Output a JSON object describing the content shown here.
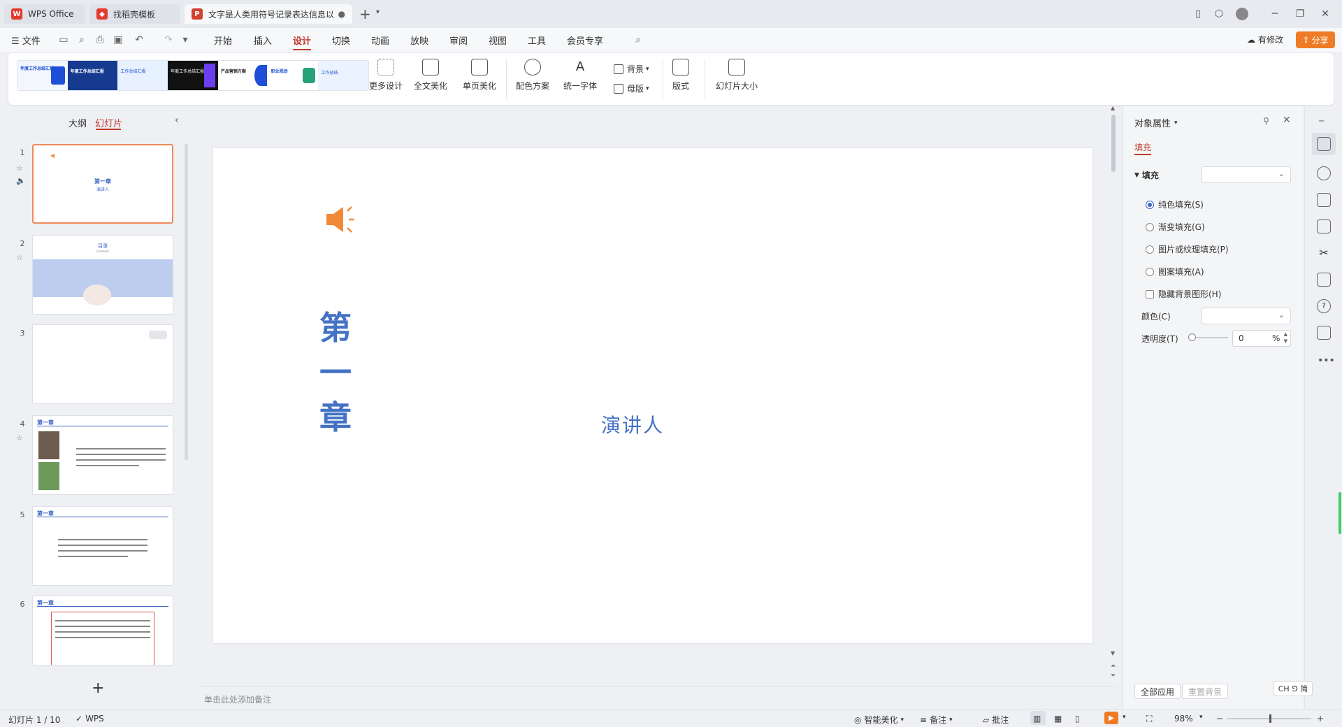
{
  "titlebar": {
    "tabs": [
      {
        "label": "WPS Office"
      },
      {
        "label": "找稻壳模板"
      },
      {
        "label": "文字是人类用符号记录表达信息以"
      }
    ],
    "new_tab_glyph": "+"
  },
  "menubar": {
    "file": "文件",
    "items": [
      "开始",
      "插入",
      "设计",
      "切换",
      "动画",
      "放映",
      "审阅",
      "视图",
      "工具",
      "会员专享"
    ],
    "active": "设计",
    "has_changes": "有修改",
    "share": "分享"
  },
  "ribbon": {
    "more_design": "更多设计",
    "beautify_all": "全文美化",
    "beautify_page": "单页美化",
    "color_scheme": "配色方案",
    "unify_font": "统一字体",
    "background": "背景",
    "master": "母版",
    "layout": "版式",
    "slide_size": "幻灯片大小",
    "templates": [
      {
        "title": "年度工作总结汇报",
        "color": "#1e4fd6"
      },
      {
        "title": "年度工作总结汇报",
        "color": "#163a8f"
      },
      {
        "title": "工作总结汇报",
        "color": "#e8f1ff"
      },
      {
        "title": "年度工作总结汇报",
        "color": "#111111"
      },
      {
        "title": "产品营销方案",
        "color": "#ffffff"
      },
      {
        "title": "职业规划",
        "color": "#1e4fd6"
      },
      {
        "title": "工作总结",
        "color": "#eaf3ff"
      }
    ]
  },
  "leftpanel": {
    "tab_outline": "大纲",
    "tab_slides": "幻灯片",
    "slides": [
      {
        "num": "1",
        "title": "第一章",
        "sub": "演讲人"
      },
      {
        "num": "2",
        "title": "目录",
        "sub": "Contents"
      },
      {
        "num": "3"
      },
      {
        "num": "4",
        "title": "第一章"
      },
      {
        "num": "5",
        "title": "第一章"
      },
      {
        "num": "6",
        "title": "第一章"
      }
    ],
    "add_glyph": "+"
  },
  "slide": {
    "title": "第一章",
    "subtitle": "演讲人"
  },
  "notes": {
    "placeholder": "单击此处添加备注"
  },
  "props": {
    "title": "对象属性",
    "tab_fill": "填充",
    "section_fill": "填充",
    "options": [
      "纯色填充(S)",
      "渐变填充(G)",
      "图片或纹理填充(P)",
      "图案填充(A)"
    ],
    "selected_option": "纯色填充(S)",
    "hide_bg": "隐藏背景图形(H)",
    "color_label": "颜色(C)",
    "transparency_label": "透明度(T)",
    "transparency_value": "0",
    "transparency_unit": "%",
    "apply_all": "全部应用",
    "reset_bg": "重置背景"
  },
  "statusbar": {
    "slide_info": "幻灯片 1 / 10",
    "wps": "WPS",
    "smart_beautify": "智能美化",
    "notes": "备注",
    "comments": "批注",
    "zoom": "98%",
    "ime": "CH ⅁ 简"
  },
  "colors": {
    "accent": "#c0392b",
    "share_bg": "#f07b26",
    "slide_title": "#4472c4",
    "speaker_icon": "#f08a3a"
  }
}
